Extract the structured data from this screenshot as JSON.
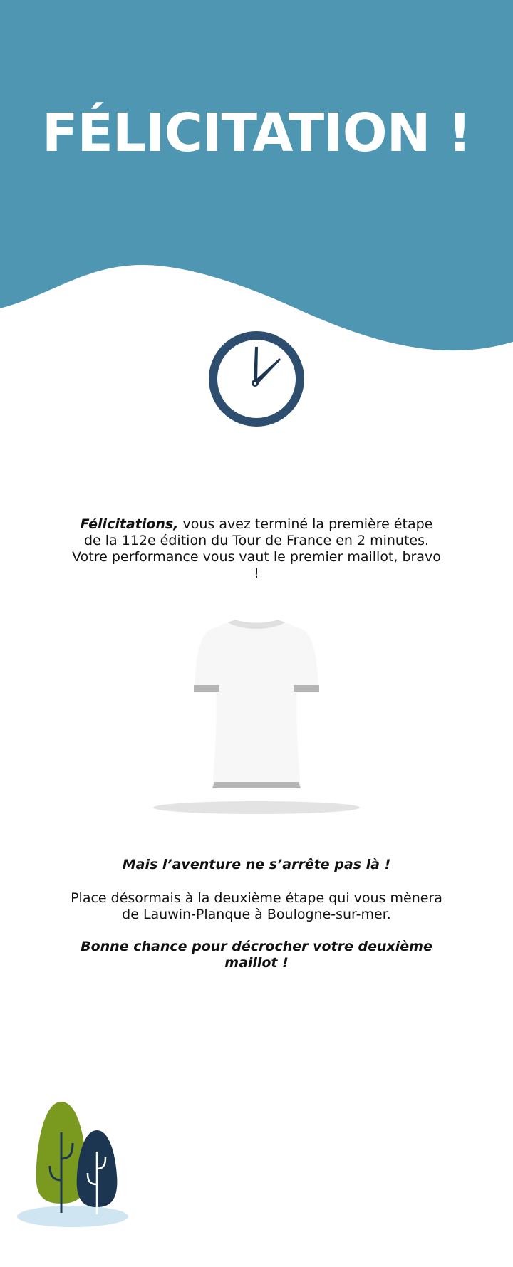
{
  "header": {
    "title": "FÉLICITATION !",
    "background_color": "#4f96b2"
  },
  "icons": {
    "clock": "clock-icon",
    "shirt": "jersey-icon",
    "trees": "trees-illustration"
  },
  "message": {
    "lead": "Félicitations,",
    "body": " vous avez terminé la première étape de la 112e édition du Tour de France en 2 minutes. Votre performance vous vaut le premier maillot, bravo !",
    "subheading": "Mais l’aventure ne s’arrête pas là !",
    "next_stage": "Place désormais à la deuxième étape qui vous mènera de Lauwin-Planque à Boulogne-sur-mer.",
    "good_luck": "Bonne chance pour décrocher votre deuxième maillot !"
  },
  "colors": {
    "clock": "#2d4e6e",
    "tree_green": "#7a9a1f",
    "tree_navy": "#1c3550",
    "ground": "#cfe6f2",
    "jersey": "#f7f7f7",
    "jersey_trim": "#b5b5b5"
  }
}
